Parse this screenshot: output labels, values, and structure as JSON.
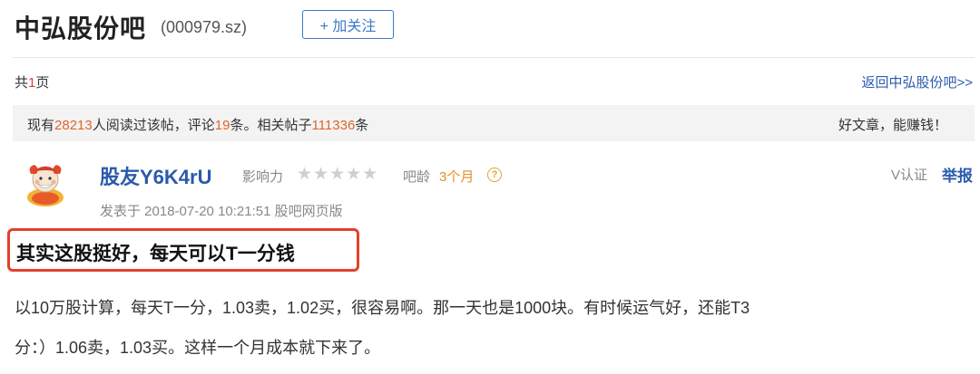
{
  "header": {
    "bar_title": "中弘股份吧",
    "stock_code": "(000979.sz)",
    "follow_label": "+ 加关注"
  },
  "page_info": {
    "prefix": "共",
    "count": "1",
    "suffix": "页",
    "back_link": "返回中弘股份吧>>"
  },
  "stats": {
    "t1": "现有",
    "reads": "28213",
    "t2": "人阅读过该帖，评论",
    "comments": "19",
    "t3": "条。相关帖子",
    "related": "111336",
    "t4": "条",
    "right_text": "好文章，能赚钱！"
  },
  "author": {
    "avatar_icon": "mascot-avatar-icon",
    "name": "股友Y6K4rU",
    "influence_label": "影响力",
    "influence_stars": "★★★★★",
    "age_label": "吧龄",
    "age_value": "3个月",
    "help_icon": "?",
    "v_cert": "V认证",
    "report": "举报",
    "post_meta": "发表于 2018-07-20 10:21:51 股吧网页版"
  },
  "post": {
    "title": "其实这股挺好，每天可以T一分钱",
    "body_line1": "以10万股计算，每天T一分，1.03卖，1.02买，很容易啊。那一天也是1000块。有时候运气好，还能T3",
    "body_line2": "分：）1.06卖，1.03买。这样一个月成本就下来了。"
  },
  "colors": {
    "link_blue": "#2a5bab",
    "highlight_orange": "#e0662a",
    "box_red": "#e2412b"
  }
}
